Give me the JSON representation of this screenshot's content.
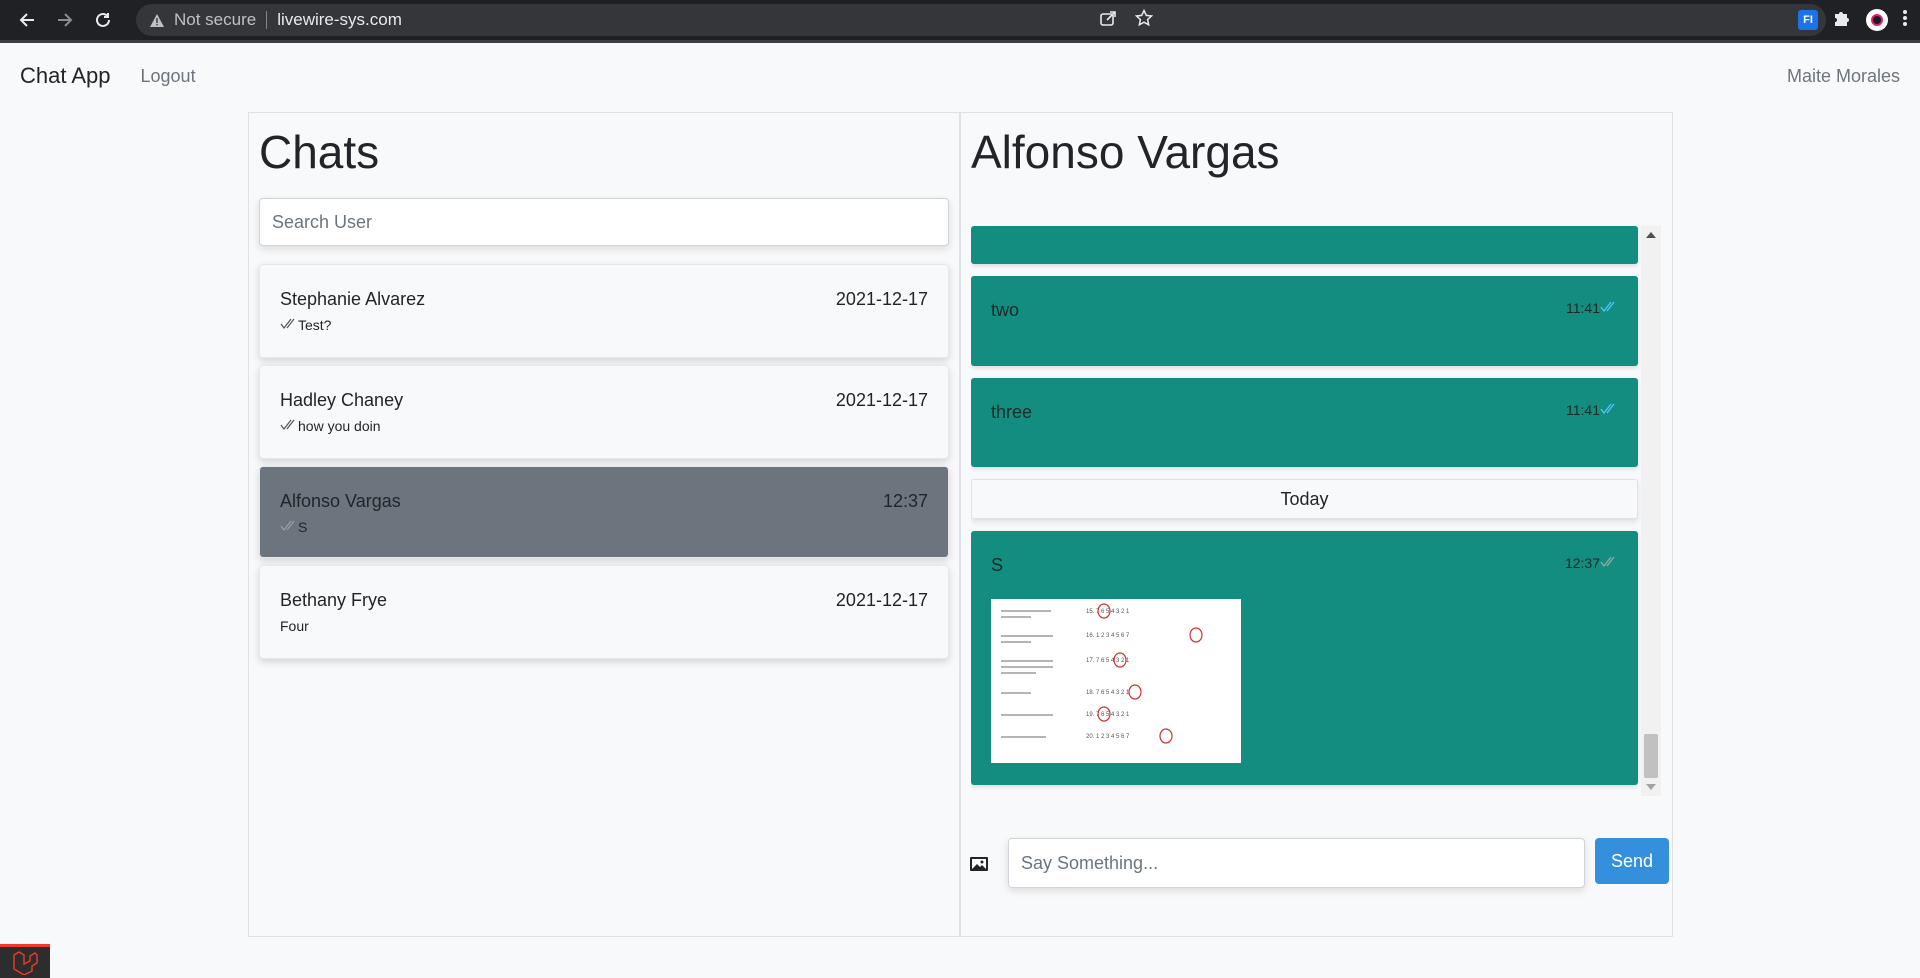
{
  "browser": {
    "security_label": "Not secure",
    "host": "livewire-sys.com",
    "extension_label": "FI"
  },
  "navbar": {
    "brand": "Chat App",
    "logout_label": "Logout",
    "user_name": "Maite Morales"
  },
  "sidebar": {
    "title": "Chats",
    "search_placeholder": "Search User",
    "chats": [
      {
        "name": "Stephanie Alvarez",
        "time": "2021-12-17",
        "preview": "Test?",
        "read_ticks": true,
        "active": false
      },
      {
        "name": "Hadley Chaney",
        "time": "2021-12-17",
        "preview": "how you doin",
        "read_ticks": true,
        "active": false
      },
      {
        "name": "Alfonso Vargas",
        "time": "12:37",
        "preview": "S",
        "read_ticks": true,
        "active": true
      },
      {
        "name": "Bethany Frye",
        "time": "2021-12-17",
        "preview": "Four",
        "read_ticks": false,
        "active": false
      }
    ]
  },
  "conversation": {
    "title": "Alfonso Vargas",
    "messages": [
      {
        "text": "two",
        "time": "11:41",
        "tick_color": "#4fc3f7"
      },
      {
        "text": "three",
        "time": "11:41",
        "tick_color": "#4fc3f7"
      }
    ],
    "day_separator": "Today",
    "last_message": {
      "text": "S",
      "time": "12:37",
      "tick_color": "#9aa5a4",
      "has_image": true
    },
    "input_placeholder": "Say Something...",
    "send_label": "Send"
  },
  "colors": {
    "message_bubble": "#138d80",
    "active_chat": "#6c757d",
    "send_button": "#3490dc"
  }
}
